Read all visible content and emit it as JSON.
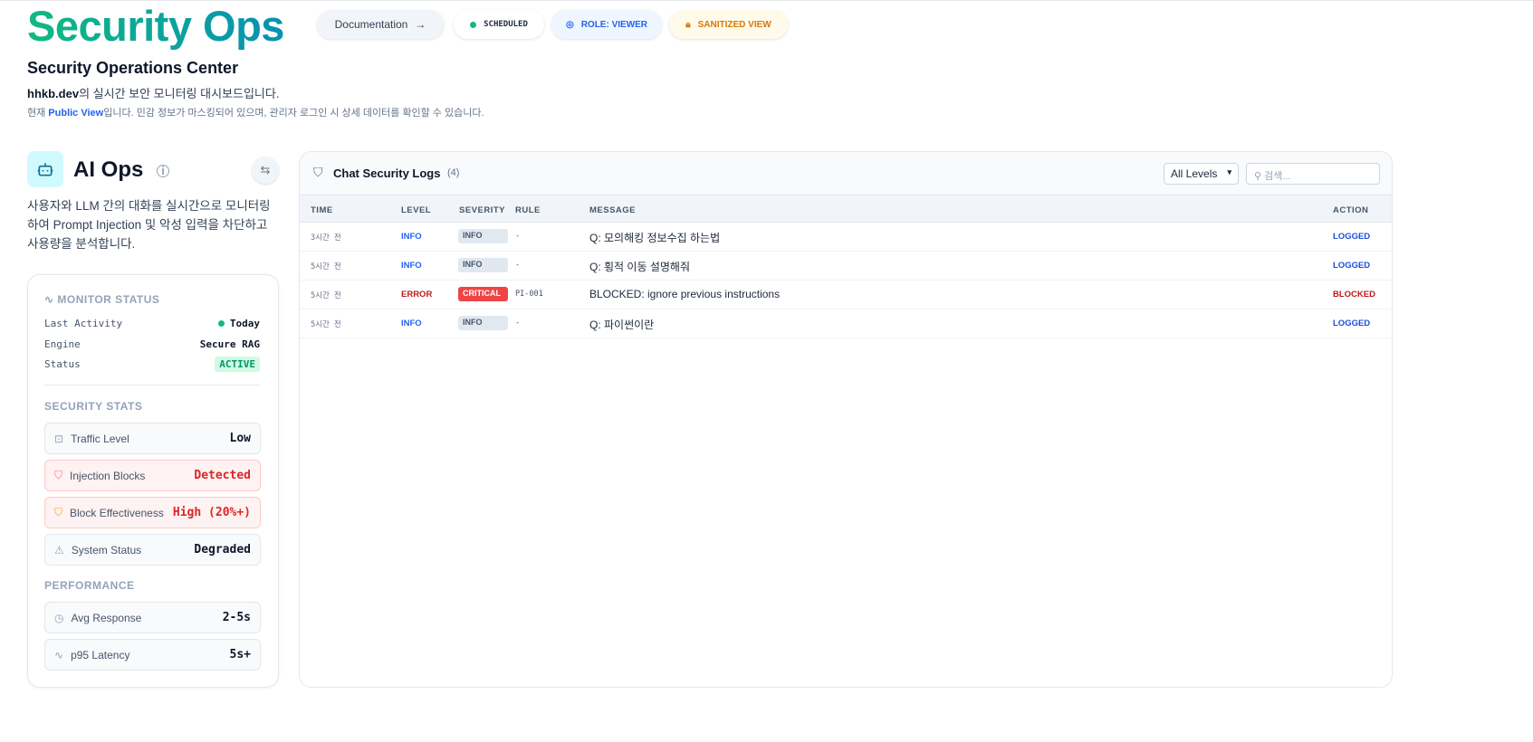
{
  "header": {
    "title": "Security Ops",
    "doc_button": "Documentation",
    "scheduled": "SCHEDULED",
    "role": "ROLE: VIEWER",
    "sanitized": "SANITIZED VIEW"
  },
  "intro": {
    "subtitle": "Security Operations Center",
    "domain": "hhkb.dev",
    "desc_rest": "의 실시간 보안 모니터링 대시보드입니다.",
    "note_prefix": "현재 ",
    "note_link": "Public View",
    "note_rest": "입니다. 민감 정보가 마스킹되어 있으며, 관리자 로그인 시 상세 데이터를 확인할 수 있습니다."
  },
  "panel": {
    "title": "AI Ops",
    "description": "사용자와 LLM 간의 대화를 실시간으로 모니터링하여 Prompt Injection 및 악성 입력을 차단하고 사용량을 분석합니다.",
    "monitor_title": "MONITOR STATUS",
    "monitor": [
      {
        "k": "Last Activity",
        "v": "Today"
      },
      {
        "k": "Engine",
        "v": "Secure RAG"
      },
      {
        "k": "Status",
        "v": "ACTIVE"
      }
    ],
    "security_title": "SECURITY STATS",
    "security": [
      {
        "label": "Traffic Level",
        "value": "Low"
      },
      {
        "label": "Injection Blocks",
        "value": "Detected"
      },
      {
        "label": "Block Effectiveness",
        "value": "High (20%+)"
      },
      {
        "label": "System Status",
        "value": "Degraded"
      }
    ],
    "performance_title": "PERFORMANCE",
    "performance": [
      {
        "label": "Avg Response",
        "value": "2-5s"
      },
      {
        "label": "p95 Latency",
        "value": "5s+"
      }
    ]
  },
  "logs": {
    "title": "Chat Security Logs",
    "count": "(4)",
    "filter": "All Levels",
    "search_placeholder": "검색...",
    "columns": [
      "TIME",
      "LEVEL",
      "SEVERITY",
      "RULE",
      "MESSAGE",
      "ACTION"
    ],
    "rows": [
      {
        "time": "3시간 전",
        "level": "INFO",
        "severity": "INFO",
        "rule": "-",
        "message": "Q: 모의해킹 정보수집 하는법",
        "action": "LOGGED"
      },
      {
        "time": "5시간 전",
        "level": "INFO",
        "severity": "INFO",
        "rule": "-",
        "message": "Q: 횡적 이동 설명해줘",
        "action": "LOGGED"
      },
      {
        "time": "5시간 전",
        "level": "ERROR",
        "severity": "CRITICAL",
        "rule": "PI-001",
        "message": "BLOCKED: ignore previous instructions",
        "action": "BLOCKED"
      },
      {
        "time": "5시간 전",
        "level": "INFO",
        "severity": "INFO",
        "rule": "-",
        "message": "Q: 파이썬이란",
        "action": "LOGGED"
      }
    ]
  },
  "colors": {
    "accent_green": "#10b981",
    "accent_teal": "#0891b2",
    "info": "#2563eb",
    "error": "#dc2626"
  }
}
